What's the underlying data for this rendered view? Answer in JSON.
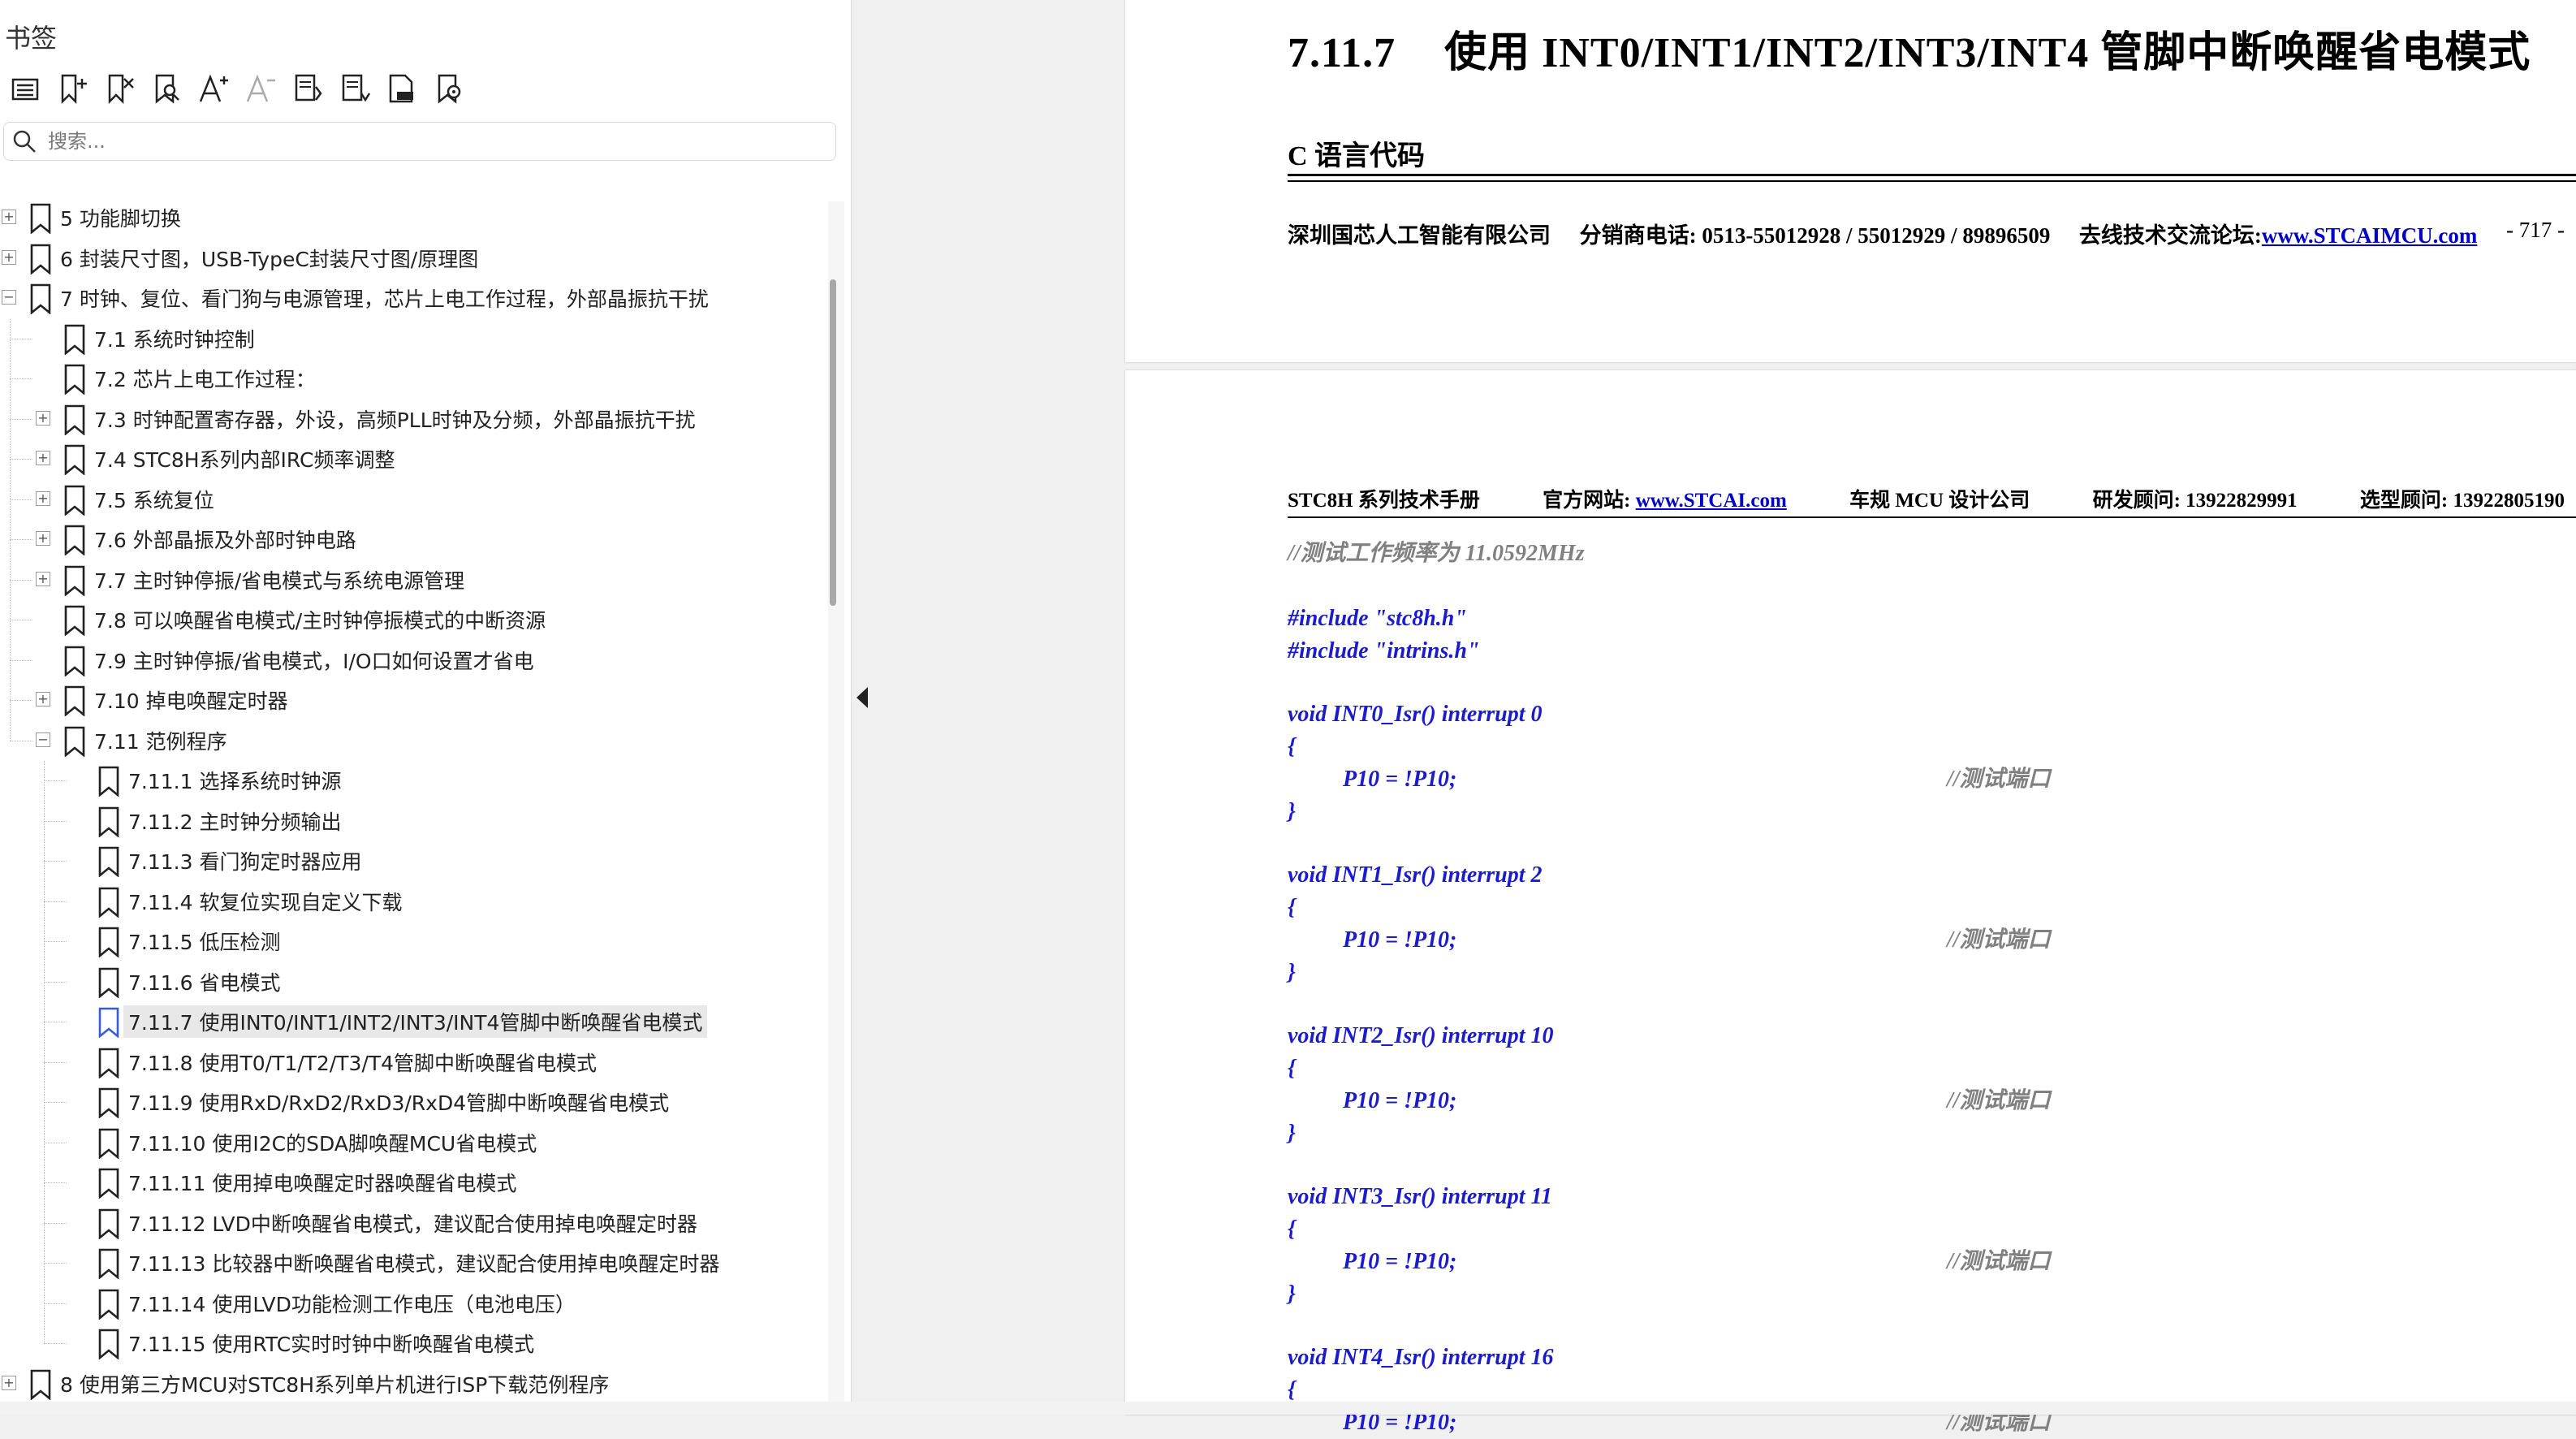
{
  "sidebar": {
    "title": "书签",
    "toolbar": [
      {
        "name": "bookmark-list-icon"
      },
      {
        "name": "add-bookmark-icon"
      },
      {
        "name": "delete-bookmark-icon"
      },
      {
        "name": "find-bookmark-icon"
      },
      {
        "name": "increase-font-icon"
      },
      {
        "name": "decrease-font-icon"
      },
      {
        "name": "expand-all-icon"
      },
      {
        "name": "collapse-all-icon"
      },
      {
        "name": "bookmark-properties-icon"
      },
      {
        "name": "bookmark-settings-icon"
      }
    ],
    "search": {
      "placeholder": "搜索..."
    },
    "tree": [
      {
        "label": "5  功能脚切换",
        "level": 0,
        "expander": "+"
      },
      {
        "label": "6  封装尺寸图，USB-TypeC封装尺寸图/原理图",
        "level": 0,
        "expander": "+"
      },
      {
        "label": "7  时钟、复位、看门狗与电源管理，芯片上电工作过程，外部晶振抗干扰",
        "level": 0,
        "expander": "-"
      },
      {
        "label": "7.1 系统时钟控制",
        "level": 1,
        "expander": ""
      },
      {
        "label": "7.2  芯片上电工作过程：",
        "level": 1,
        "expander": ""
      },
      {
        "label": "7.3  时钟配置寄存器，外设，高频PLL时钟及分频，外部晶振抗干扰",
        "level": 1,
        "expander": "+"
      },
      {
        "label": "7.4  STC8H系列内部IRC频率调整",
        "level": 1,
        "expander": "+"
      },
      {
        "label": "7.5  系统复位",
        "level": 1,
        "expander": "+"
      },
      {
        "label": "7.6  外部晶振及外部时钟电路",
        "level": 1,
        "expander": "+"
      },
      {
        "label": "7.7  主时钟停振/省电模式与系统电源管理",
        "level": 1,
        "expander": "+"
      },
      {
        "label": "7.8  可以唤醒省电模式/主时钟停振模式的中断资源",
        "level": 1,
        "expander": ""
      },
      {
        "label": "7.9  主时钟停振/省电模式，I/O口如何设置才省电",
        "level": 1,
        "expander": ""
      },
      {
        "label": "7.10  掉电唤醒定时器",
        "level": 1,
        "expander": "+"
      },
      {
        "label": "7.11  范例程序",
        "level": 1,
        "expander": "-"
      },
      {
        "label": "7.11.1 选择系统时钟源",
        "level": 2,
        "expander": ""
      },
      {
        "label": "7.11.2 主时钟分频输出",
        "level": 2,
        "expander": ""
      },
      {
        "label": "7.11.3 看门狗定时器应用",
        "level": 2,
        "expander": ""
      },
      {
        "label": "7.11.4 软复位实现自定义下载",
        "level": 2,
        "expander": ""
      },
      {
        "label": "7.11.5 低压检测",
        "level": 2,
        "expander": ""
      },
      {
        "label": "7.11.6 省电模式",
        "level": 2,
        "expander": ""
      },
      {
        "label": "7.11.7 使用INT0/INT1/INT2/INT3/INT4管脚中断唤醒省电模式",
        "level": 2,
        "expander": "",
        "selected": true
      },
      {
        "label": "7.11.8 使用T0/T1/T2/T3/T4管脚中断唤醒省电模式",
        "level": 2,
        "expander": ""
      },
      {
        "label": "7.11.9 使用RxD/RxD2/RxD3/RxD4管脚中断唤醒省电模式",
        "level": 2,
        "expander": ""
      },
      {
        "label": "7.11.10 使用I2C的SDA脚唤醒MCU省电模式",
        "level": 2,
        "expander": ""
      },
      {
        "label": "7.11.11 使用掉电唤醒定时器唤醒省电模式",
        "level": 2,
        "expander": ""
      },
      {
        "label": "7.11.12 LVD中断唤醒省电模式，建议配合使用掉电唤醒定时器",
        "level": 2,
        "expander": ""
      },
      {
        "label": "7.11.13  比较器中断唤醒省电模式，建议配合使用掉电唤醒定时器",
        "level": 2,
        "expander": ""
      },
      {
        "label": "7.11.14 使用LVD功能检测工作电压（电池电压）",
        "level": 2,
        "expander": ""
      },
      {
        "label": "7.11.15 使用RTC实时时钟中断唤醒省电模式",
        "level": 2,
        "expander": ""
      },
      {
        "label": "8  使用第三方MCU对STC8H系列单片机进行ISP下载范例程序",
        "level": 0,
        "expander": "+"
      }
    ]
  },
  "page1": {
    "section_number": "7.11.7",
    "section_title": "使用 INT0/INT1/INT2/INT3/INT4 管脚中断唤醒省电模式",
    "subtitle": "C 语言代码",
    "footer_company": "深圳国芯人工智能有限公司",
    "footer_phone": "分销商电话: 0513-55012928 / 55012929 / 89896509",
    "footer_forum_label": "去线技术交流论坛:",
    "footer_forum_link": "www.STCAIMCU.com",
    "footer_page": "- 717 -"
  },
  "page2": {
    "header_manual": "STC8H 系列技术手册",
    "header_site_label": "官方网站: ",
    "header_site_link": "www.STCAI.com",
    "header_company": "车规 MCU 设计公司",
    "header_consult": "研发顾问: 13922829991",
    "header_select": "选型顾问: 13922805190",
    "code_comment_top": "//测试工作频率为 11.0592MHz",
    "include1": "#include \"stc8h.h\"",
    "include2": "#include \"intrins.h\"",
    "isrs": [
      {
        "sig": "void INT0_Isr() interrupt 0"
      },
      {
        "sig": "void INT1_Isr() interrupt 2"
      },
      {
        "sig": "void INT2_Isr() interrupt 10"
      },
      {
        "sig": "void INT3_Isr() interrupt 11"
      },
      {
        "sig": "void INT4_Isr() interrupt 16"
      }
    ],
    "brace_open": "{",
    "brace_close": "}",
    "stmt": "P10 = !P10;",
    "stmt_comment": "//测试端口"
  }
}
